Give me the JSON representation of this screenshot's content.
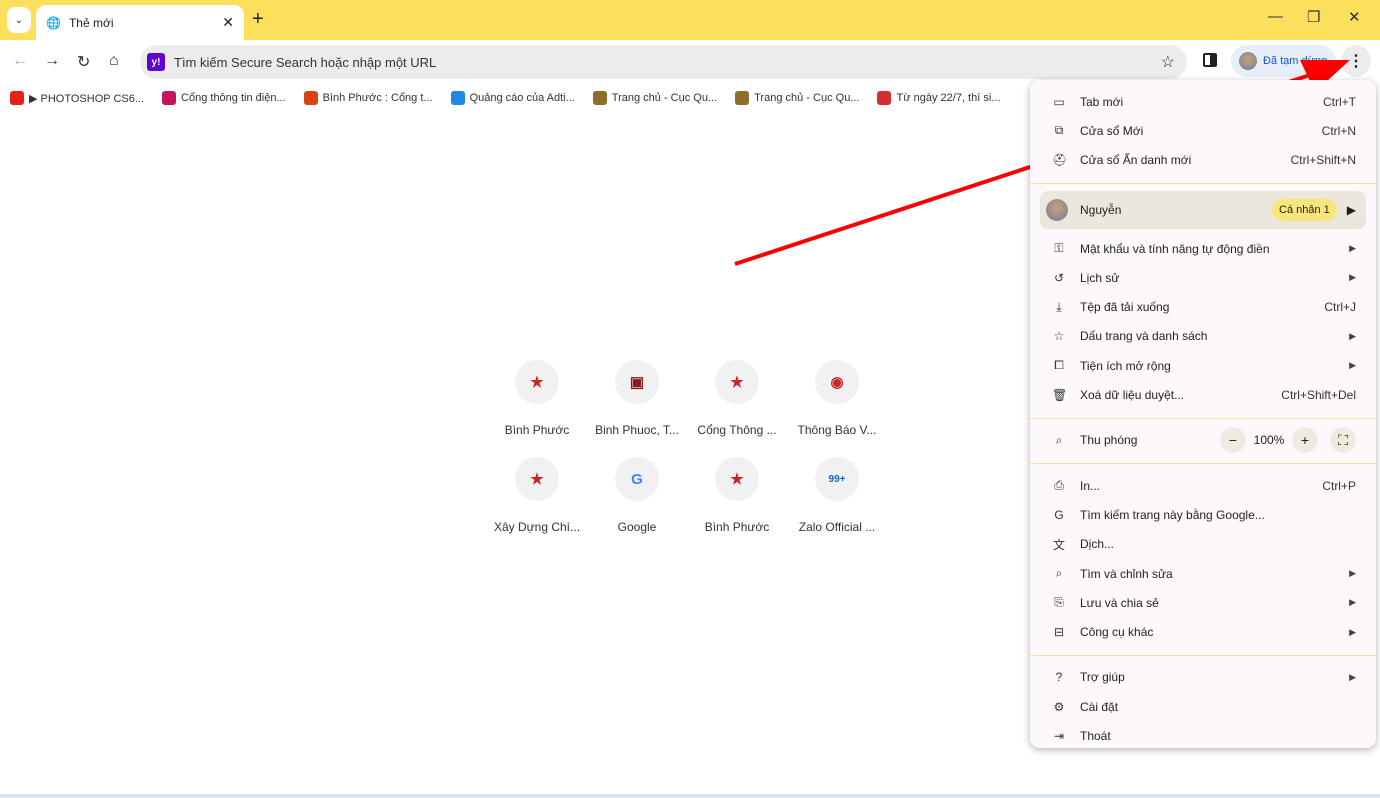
{
  "tab": {
    "title": "Thẻ mới",
    "icon": "globe-icon"
  },
  "omnibox": {
    "placeholder": "Tìm kiếm Secure Search hoặc nhập một URL"
  },
  "profile": {
    "status": "Đã tạm dừng"
  },
  "bookmarks": [
    {
      "label": "▶ PHOTOSHOP CS6...",
      "color": "#e62117"
    },
    {
      "label": "Cổng thông tin điện...",
      "color": "#c2185b"
    },
    {
      "label": "Bình Phước : Cổng t...",
      "color": "#d84315"
    },
    {
      "label": "Quảng cáo của Adti...",
      "color": "#1e88e5"
    },
    {
      "label": "Trang chủ - Cục Qu...",
      "color": "#8d6e2a"
    },
    {
      "label": "Trang chủ - Cục Qu...",
      "color": "#8d6e2a"
    },
    {
      "label": "Từ ngày 22/7, thí si...",
      "color": "#d32f2f"
    }
  ],
  "shortcuts": [
    {
      "label": "Bình Phước",
      "icon": "emblem-icon"
    },
    {
      "label": "Binh Phuoc, T...",
      "icon": "btv-icon"
    },
    {
      "label": "Cổng Thông ...",
      "icon": "emblem-icon"
    },
    {
      "label": "Thông Báo V...",
      "icon": "seal-icon"
    },
    {
      "label": "Xây Dựng Chí...",
      "icon": "emblem-icon"
    },
    {
      "label": "Google",
      "icon": "google-icon"
    },
    {
      "label": "Bình Phước",
      "icon": "emblem-icon"
    },
    {
      "label": "Zalo Official ...",
      "icon": "zalo-icon"
    }
  ],
  "menu": {
    "group1": [
      {
        "label": "Tab mới",
        "shortcut": "Ctrl+T",
        "icon": "tab-icon",
        "glyph": "▭"
      },
      {
        "label": "Cửa sổ Mới",
        "shortcut": "Ctrl+N",
        "icon": "new-window-icon",
        "glyph": "⧉"
      },
      {
        "label": "Cửa sổ Ẩn danh mới",
        "shortcut": "Ctrl+Shift+N",
        "icon": "incognito-icon",
        "glyph": "⛑"
      }
    ],
    "profile": {
      "name": "Nguyễn",
      "badge": "Cá nhân 1"
    },
    "group2": [
      {
        "label": "Mật khẩu và tính năng tự động điền",
        "arrow": "▶",
        "icon": "key-icon",
        "glyph": "⚿"
      },
      {
        "label": "Lịch sử",
        "arrow": "▶",
        "icon": "history-icon",
        "glyph": "↺"
      },
      {
        "label": "Tệp đã tải xuống",
        "shortcut": "Ctrl+J",
        "icon": "download-icon",
        "glyph": "⤓"
      },
      {
        "label": "Dấu trang và danh sách",
        "arrow": "▶",
        "icon": "star-icon",
        "glyph": "☆"
      },
      {
        "label": "Tiện ích mở rộng",
        "arrow": "▶",
        "icon": "extension-icon",
        "glyph": "⧠"
      },
      {
        "label": "Xoá dữ liệu duyệt...",
        "shortcut": "Ctrl+Shift+Del",
        "icon": "trash-icon",
        "glyph": "🗑"
      }
    ],
    "zoom": {
      "label": "Thu phóng",
      "value": "100%",
      "minus": "−",
      "plus": "+"
    },
    "group3": [
      {
        "label": "In...",
        "shortcut": "Ctrl+P",
        "icon": "print-icon",
        "glyph": "⎙"
      },
      {
        "label": "Tìm kiếm trang này bằng Google...",
        "icon": "google-icon",
        "glyph": "G"
      },
      {
        "label": "Dịch...",
        "icon": "translate-icon",
        "glyph": "文"
      },
      {
        "label": "Tìm và chỉnh sửa",
        "arrow": "▶",
        "icon": "find-icon",
        "glyph": "⌕"
      },
      {
        "label": "Lưu và chia sẻ",
        "arrow": "▶",
        "icon": "save-share-icon",
        "glyph": "⎘"
      },
      {
        "label": "Công cụ khác",
        "arrow": "▶",
        "icon": "toolbox-icon",
        "glyph": "⊟"
      }
    ],
    "group4": [
      {
        "label": "Trợ giúp",
        "arrow": "▶",
        "icon": "help-icon",
        "glyph": "?"
      },
      {
        "label": "Cài đặt",
        "icon": "settings-icon",
        "glyph": "⚙"
      },
      {
        "label": "Thoát",
        "icon": "exit-icon",
        "glyph": "⇥"
      }
    ]
  },
  "colors": {
    "titlebar": "#fddf5e",
    "annotation_arrow": "#ff0000",
    "menu_bg": "#fdf8fc"
  }
}
